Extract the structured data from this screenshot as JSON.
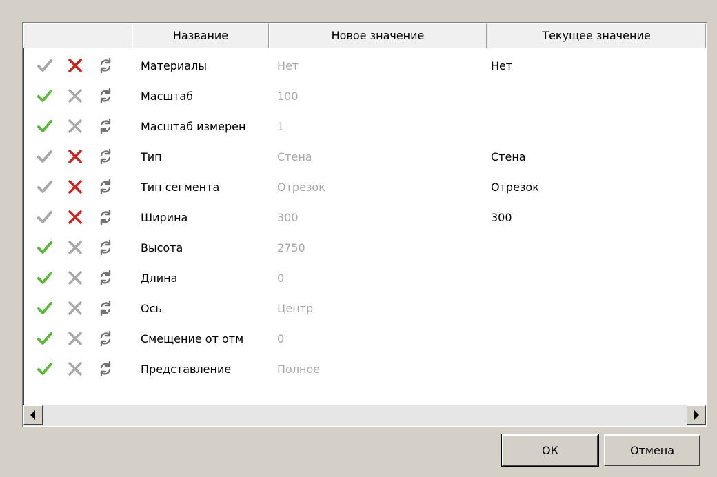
{
  "columns": {
    "name": "Название",
    "new_value": "Новое значение",
    "current_value": "Текущее значение"
  },
  "rows": [
    {
      "name": "Материалы",
      "new_value": "Нет",
      "current_value": "Нет",
      "accept_enabled": false,
      "reject_enabled": true
    },
    {
      "name": "Масштаб",
      "new_value": "100",
      "current_value": "",
      "accept_enabled": true,
      "reject_enabled": false
    },
    {
      "name": "Масштаб измерен",
      "new_value": "1",
      "current_value": "",
      "accept_enabled": true,
      "reject_enabled": false
    },
    {
      "name": "Тип",
      "new_value": "Стена",
      "current_value": "Стена",
      "accept_enabled": false,
      "reject_enabled": true
    },
    {
      "name": "Тип сегмента",
      "new_value": "Отрезок",
      "current_value": "Отрезок",
      "accept_enabled": false,
      "reject_enabled": true
    },
    {
      "name": "Ширина",
      "new_value": "300",
      "current_value": "300",
      "accept_enabled": false,
      "reject_enabled": true
    },
    {
      "name": "Высота",
      "new_value": "2750",
      "current_value": "",
      "accept_enabled": true,
      "reject_enabled": false
    },
    {
      "name": "Длина",
      "new_value": "0",
      "current_value": "",
      "accept_enabled": true,
      "reject_enabled": false
    },
    {
      "name": "Ось",
      "new_value": "Центр",
      "current_value": "",
      "accept_enabled": true,
      "reject_enabled": false
    },
    {
      "name": "Смещение от отм",
      "new_value": "0",
      "current_value": "",
      "accept_enabled": true,
      "reject_enabled": false
    },
    {
      "name": "Представление",
      "new_value": "Полное",
      "current_value": "",
      "accept_enabled": true,
      "reject_enabled": false
    }
  ],
  "icons": {
    "accept": "checkmark-icon",
    "reject": "cross-icon",
    "reset": "refresh-icon"
  },
  "colors": {
    "accept_active": "#5cb83a",
    "accept_inactive": "#a8a8a8",
    "reject_active": "#d02020",
    "reject_inactive": "#a8a8a8",
    "reset": "#707070"
  },
  "buttons": {
    "ok": "ОК",
    "cancel": "Отмена"
  }
}
